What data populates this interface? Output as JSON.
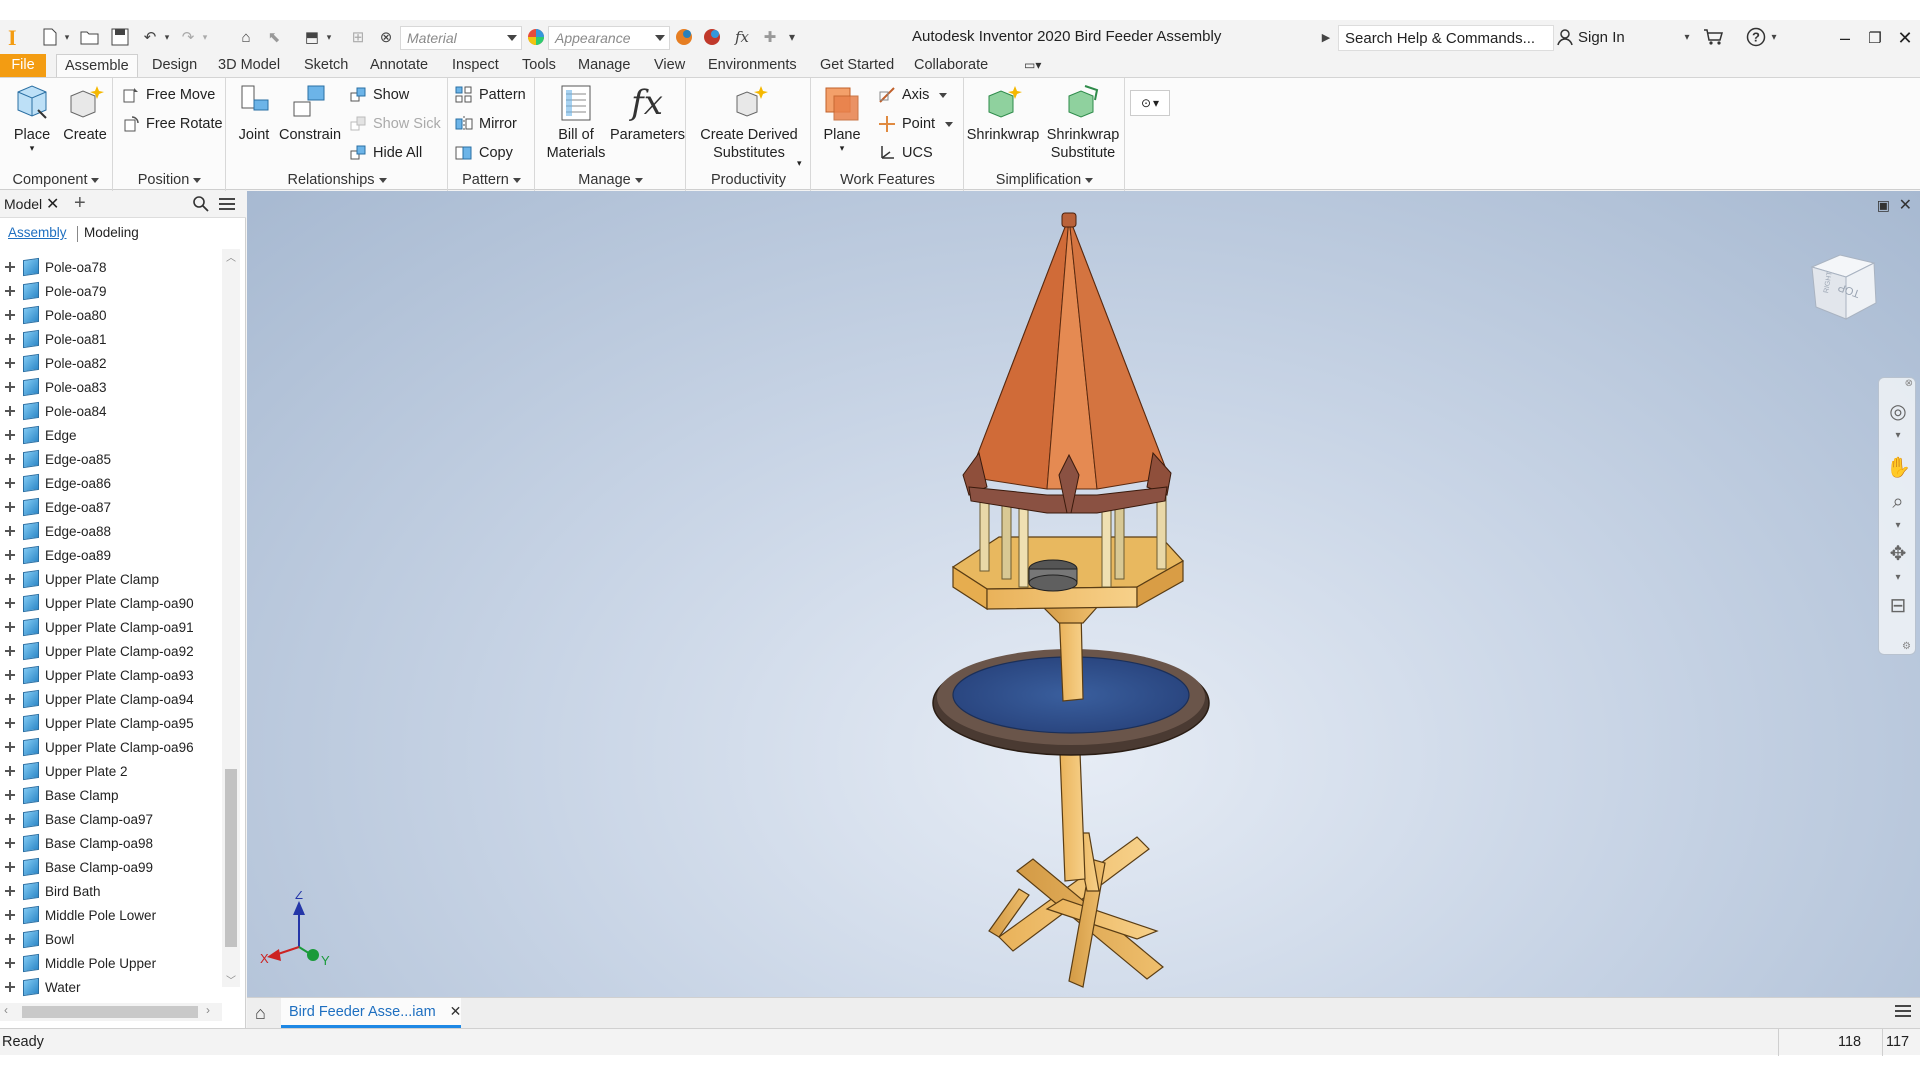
{
  "window": {
    "app_title": "Autodesk Inventor 2020   Bird Feeder Assembly",
    "search_placeholder": "Search Help & Commands...",
    "sign_in": "Sign In"
  },
  "quick_access": {
    "material_label": "Material",
    "appearance_label": "Appearance"
  },
  "ribbon_tabs": [
    "File",
    "Assemble",
    "Design",
    "3D Model",
    "Sketch",
    "Annotate",
    "Inspect",
    "Tools",
    "Manage",
    "View",
    "Environments",
    "Get Started",
    "Collaborate"
  ],
  "active_tab": "Assemble",
  "ribbon": {
    "component": {
      "label": "Component",
      "place": "Place",
      "create": "Create"
    },
    "position": {
      "label": "Position",
      "free_move": "Free Move",
      "free_rotate": "Free Rotate"
    },
    "relationships": {
      "label": "Relationships",
      "joint": "Joint",
      "constrain": "Constrain",
      "show": "Show",
      "show_sick": "Show Sick",
      "hide_all": "Hide All"
    },
    "pattern": {
      "label": "Pattern",
      "pattern": "Pattern",
      "mirror": "Mirror",
      "copy": "Copy"
    },
    "manage": {
      "label": "Manage",
      "bom_line1": "Bill of",
      "bom_line2": "Materials",
      "parameters": "Parameters"
    },
    "productivity": {
      "label": "Productivity",
      "derived_line1": "Create Derived",
      "derived_line2": "Substitutes"
    },
    "work_features": {
      "label": "Work Features",
      "plane": "Plane",
      "axis": "Axis",
      "point": "Point",
      "ucs": "UCS"
    },
    "simplification": {
      "label": "Simplification",
      "shrinkwrap": "Shrinkwrap",
      "shrinkwrap_sub_line1": "Shrinkwrap",
      "shrinkwrap_sub_line2": "Substitute"
    }
  },
  "browser": {
    "title": "Model",
    "subtab_assembly": "Assembly",
    "subtab_modeling": "Modeling",
    "items": [
      "Pole-oa78",
      "Pole-oa79",
      "Pole-oa80",
      "Pole-oa81",
      "Pole-oa82",
      "Pole-oa83",
      "Pole-oa84",
      "Edge",
      "Edge-oa85",
      "Edge-oa86",
      "Edge-oa87",
      "Edge-oa88",
      "Edge-oa89",
      "Upper Plate Clamp",
      "Upper Plate Clamp-oa90",
      "Upper Plate Clamp-oa91",
      "Upper Plate Clamp-oa92",
      "Upper Plate Clamp-oa93",
      "Upper Plate Clamp-oa94",
      "Upper Plate Clamp-oa95",
      "Upper Plate Clamp-oa96",
      "Upper Plate 2",
      "Base Clamp",
      "Base Clamp-oa97",
      "Base Clamp-oa98",
      "Base Clamp-oa99",
      "Bird Bath",
      "Middle Pole Lower",
      "Bowl",
      "Middle Pole Upper",
      "Water"
    ]
  },
  "viewport": {
    "triad": {
      "x": "X",
      "z": "Z",
      "y": "Y"
    },
    "viewcube_top": "TOP",
    "viewcube_right": "RIGHT"
  },
  "document_tab": {
    "label": "Bird Feeder Asse...iam"
  },
  "status": {
    "text": "Ready",
    "num1": "118",
    "num2": "117"
  },
  "colors": {
    "file_tab": "#f39c12",
    "accent_blue": "#1e88e5",
    "roof": "#d9783f",
    "wood": "#f2c46b",
    "bath": "#2e4e86"
  }
}
